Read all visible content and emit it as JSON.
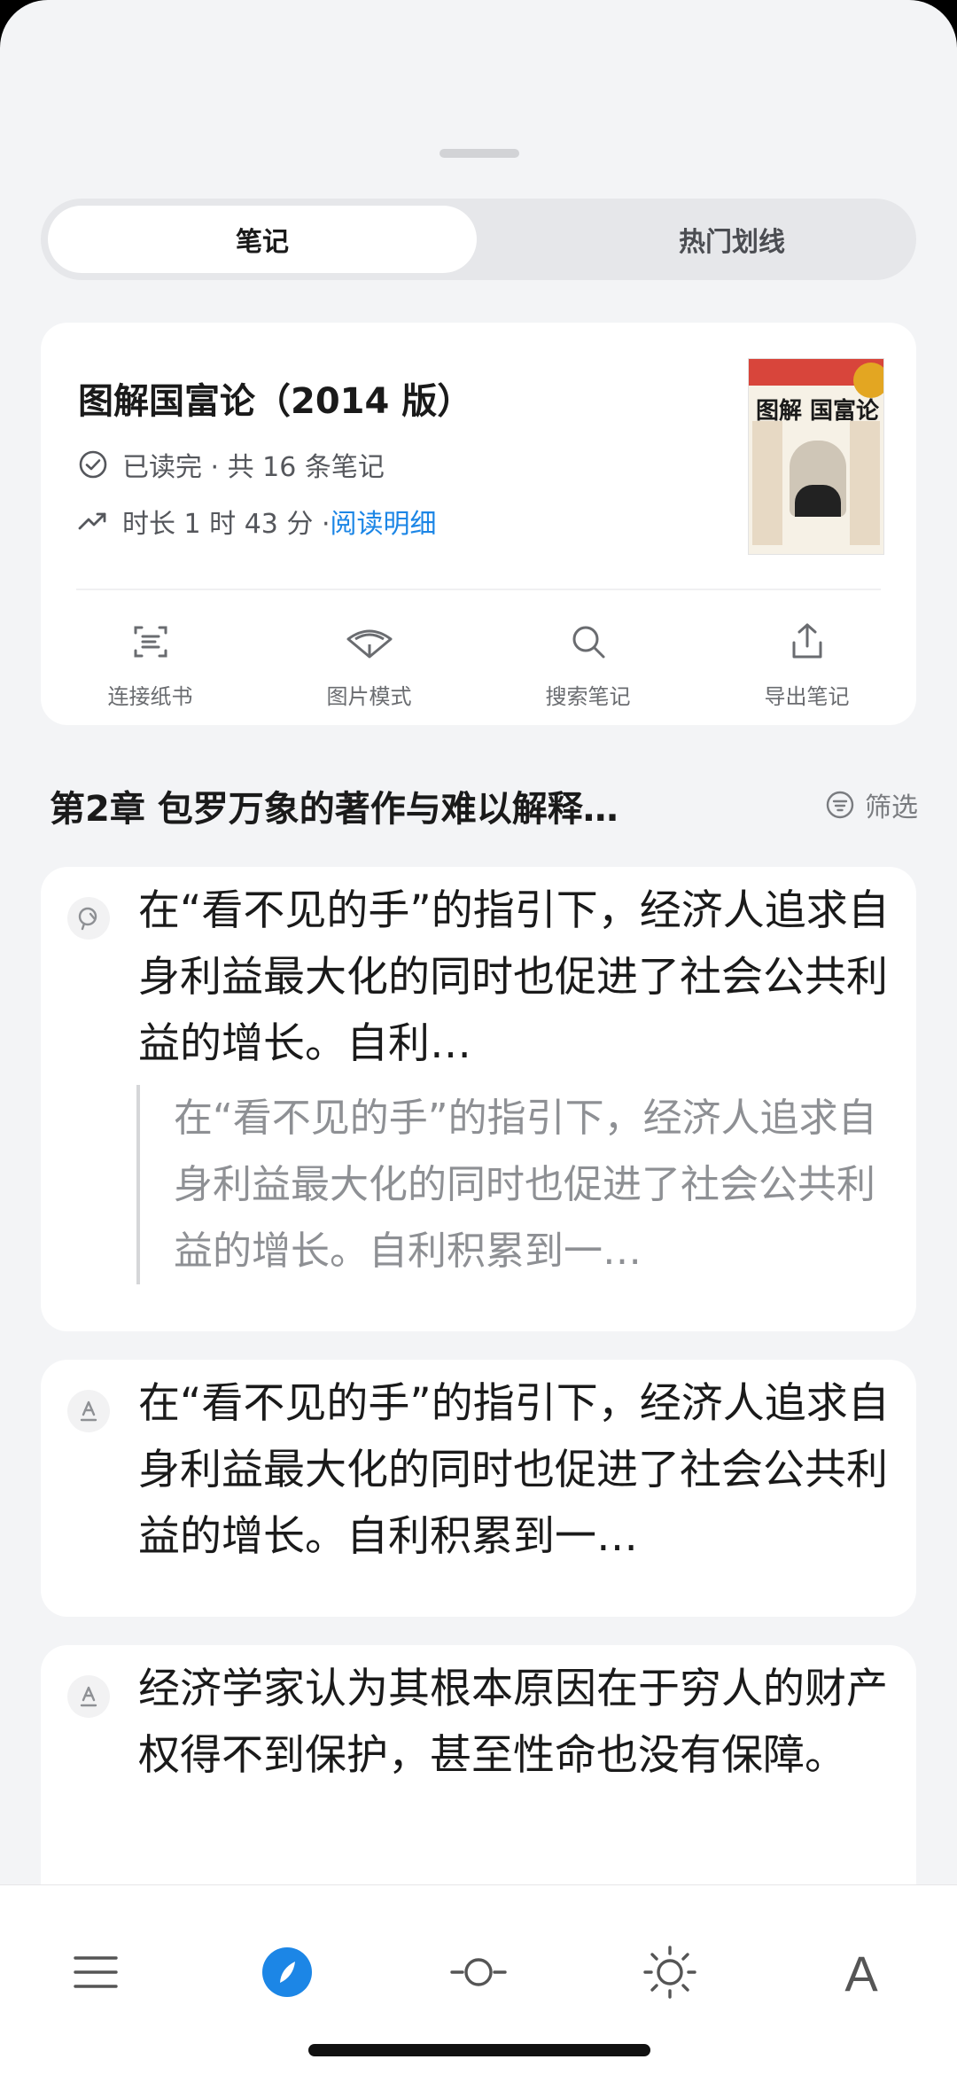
{
  "tabs": [
    {
      "label": "笔记",
      "active": true
    },
    {
      "label": "热门划线",
      "active": false
    }
  ],
  "book": {
    "title": "图解国富论（2014 版）",
    "status": "已读完 · 共 16 条笔记",
    "duration": "时长 1 时 43 分 · ",
    "detail_link": "阅读明细",
    "cover_title": "图解 国富论"
  },
  "actions": [
    {
      "label": "连接纸书",
      "icon": "scan-icon"
    },
    {
      "label": "图片模式",
      "icon": "fan-icon"
    },
    {
      "label": "搜索笔记",
      "icon": "search-icon"
    },
    {
      "label": "导出笔记",
      "icon": "share-icon"
    }
  ],
  "chapter": {
    "title": "第2章 包罗万象的著作与难以解释…",
    "filter_label": "筛选"
  },
  "notes": [
    {
      "icon": "thought-icon",
      "text": "在“看不见的手”的指引下，经济人追求自身利益最大化的同时也促进了社会公共利益的增长。自利…",
      "quote": "在“看不见的手”的指引下，经济人追求自身利益最大化的同时也促进了社会公共利益的增长。自利积累到一…"
    },
    {
      "icon": "underline-icon",
      "text": "在“看不见的手”的指引下，经济人追求自身利益最大化的同时也促进了社会公共利益的增长。自利积累到一…"
    },
    {
      "icon": "underline-icon",
      "text": "经济学家认为其根本原因在于穷人的财产权得不到保护，甚至性命也没有保障。"
    }
  ],
  "toolbar": [
    {
      "icon": "menu-icon"
    },
    {
      "icon": "compass-icon"
    },
    {
      "icon": "progress-icon"
    },
    {
      "icon": "brightness-icon"
    },
    {
      "icon": "font-icon",
      "label": "A"
    }
  ],
  "colors": {
    "accent": "#1c86e6",
    "background": "#f3f4f6",
    "card": "#ffffff"
  }
}
